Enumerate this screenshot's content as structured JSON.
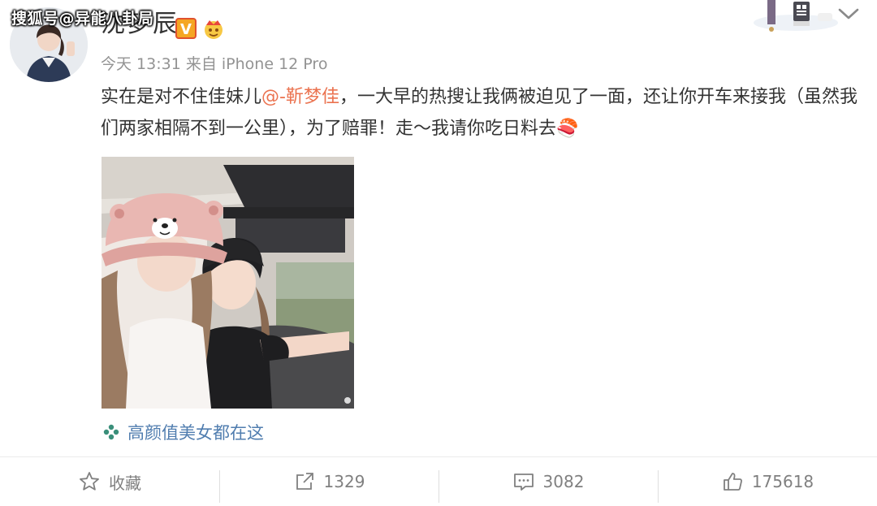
{
  "watermark": "搜狐号@异能八卦局",
  "user": {
    "name": "沈梦辰",
    "verified_badge": "V"
  },
  "meta": {
    "time": "今天 13:31",
    "source_prefix": "来自",
    "device": "iPhone 12 Pro"
  },
  "post": {
    "text_before": "实在是对不住佳妹儿",
    "mention": "@-靳梦佳",
    "text_after": "，一大早的热搜让我俩被迫见了一面，还让你开车来接我（虽然我们两家相隔不到一公里），为了赔罪！走～我请你吃日料去",
    "emoji": "🍣"
  },
  "topic": {
    "label": "高颜值美女都在这"
  },
  "actions": {
    "favorite_label": "收藏",
    "repost_count": "1329",
    "comment_count": "3082",
    "like_count": "175618"
  },
  "colors": {
    "mention": "#eb7350",
    "topic": "#507daf",
    "meta": "#939393",
    "action": "#808080"
  }
}
